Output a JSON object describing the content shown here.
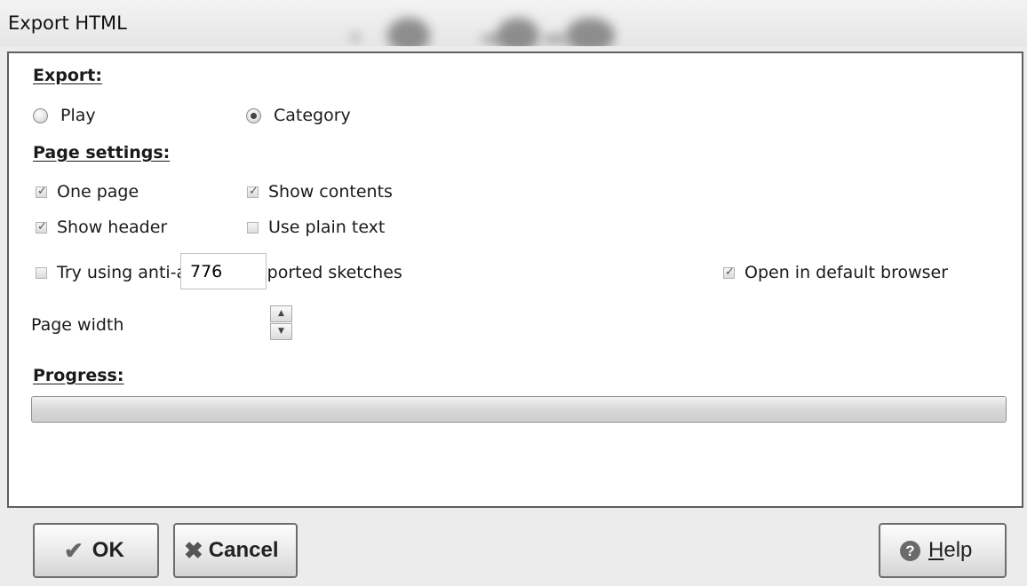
{
  "window": {
    "title": "Export HTML"
  },
  "export_section": {
    "heading": "Export:",
    "options": [
      {
        "label": "Play",
        "selected": false
      },
      {
        "label": "Category",
        "selected": true
      }
    ]
  },
  "page_settings": {
    "heading": "Page settings:",
    "one_page": {
      "label": "One page",
      "checked": true
    },
    "show_contents": {
      "label": "Show contents",
      "checked": true
    },
    "show_header": {
      "label": "Show header",
      "checked": true
    },
    "use_plain_text": {
      "label": "Use plain text",
      "checked": false
    },
    "anti_alias": {
      "label": "Try using anti-alias on exported sketches",
      "checked": false
    },
    "open_browser": {
      "label": "Open in default browser",
      "checked": true
    },
    "page_width": {
      "label": "Page width",
      "value": "776"
    }
  },
  "progress": {
    "heading": "Progress:",
    "percent": 0
  },
  "buttons": {
    "ok": "OK",
    "cancel": "Cancel",
    "help_mnemonic": "H",
    "help_rest": "elp"
  },
  "icons": {
    "ok": "checkmark-icon",
    "cancel": "x-icon",
    "help": "question-icon"
  }
}
